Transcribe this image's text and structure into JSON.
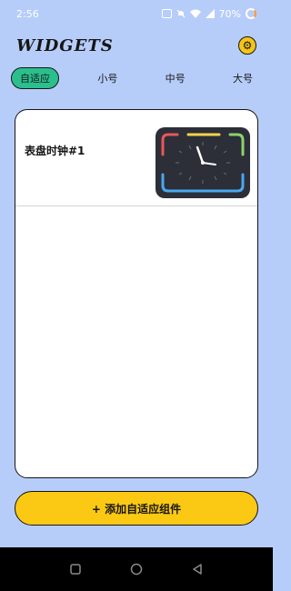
{
  "status_bar": {
    "time": "2:56",
    "battery": "70%",
    "icons": [
      "screenshot-icon",
      "mute-icon",
      "wifi-icon",
      "signal-icon",
      "battery-icon"
    ]
  },
  "header": {
    "title": "WIDGETS",
    "settings_icon": "gear-icon"
  },
  "tabs": [
    {
      "label": "自适应",
      "active": true
    },
    {
      "label": "小号",
      "active": false
    },
    {
      "label": "中号",
      "active": false
    },
    {
      "label": "大号",
      "active": false
    }
  ],
  "widgets": [
    {
      "name": "表盘时钟#1",
      "preview": "clock-face"
    }
  ],
  "add_button": {
    "label": "+ 添加自适应组件"
  },
  "nav_bar": {
    "icons": [
      "recents-icon",
      "home-icon",
      "back-icon"
    ]
  },
  "colors": {
    "background": "#b7cdf9",
    "active_tab": "#2bbf8e",
    "accent": "#fbc913",
    "clock_bg": "#2c2e38",
    "clock_red": "#e8575a",
    "clock_yellow": "#f4d34a",
    "clock_green": "#8bd36a",
    "clock_blue": "#4aa7f0"
  }
}
